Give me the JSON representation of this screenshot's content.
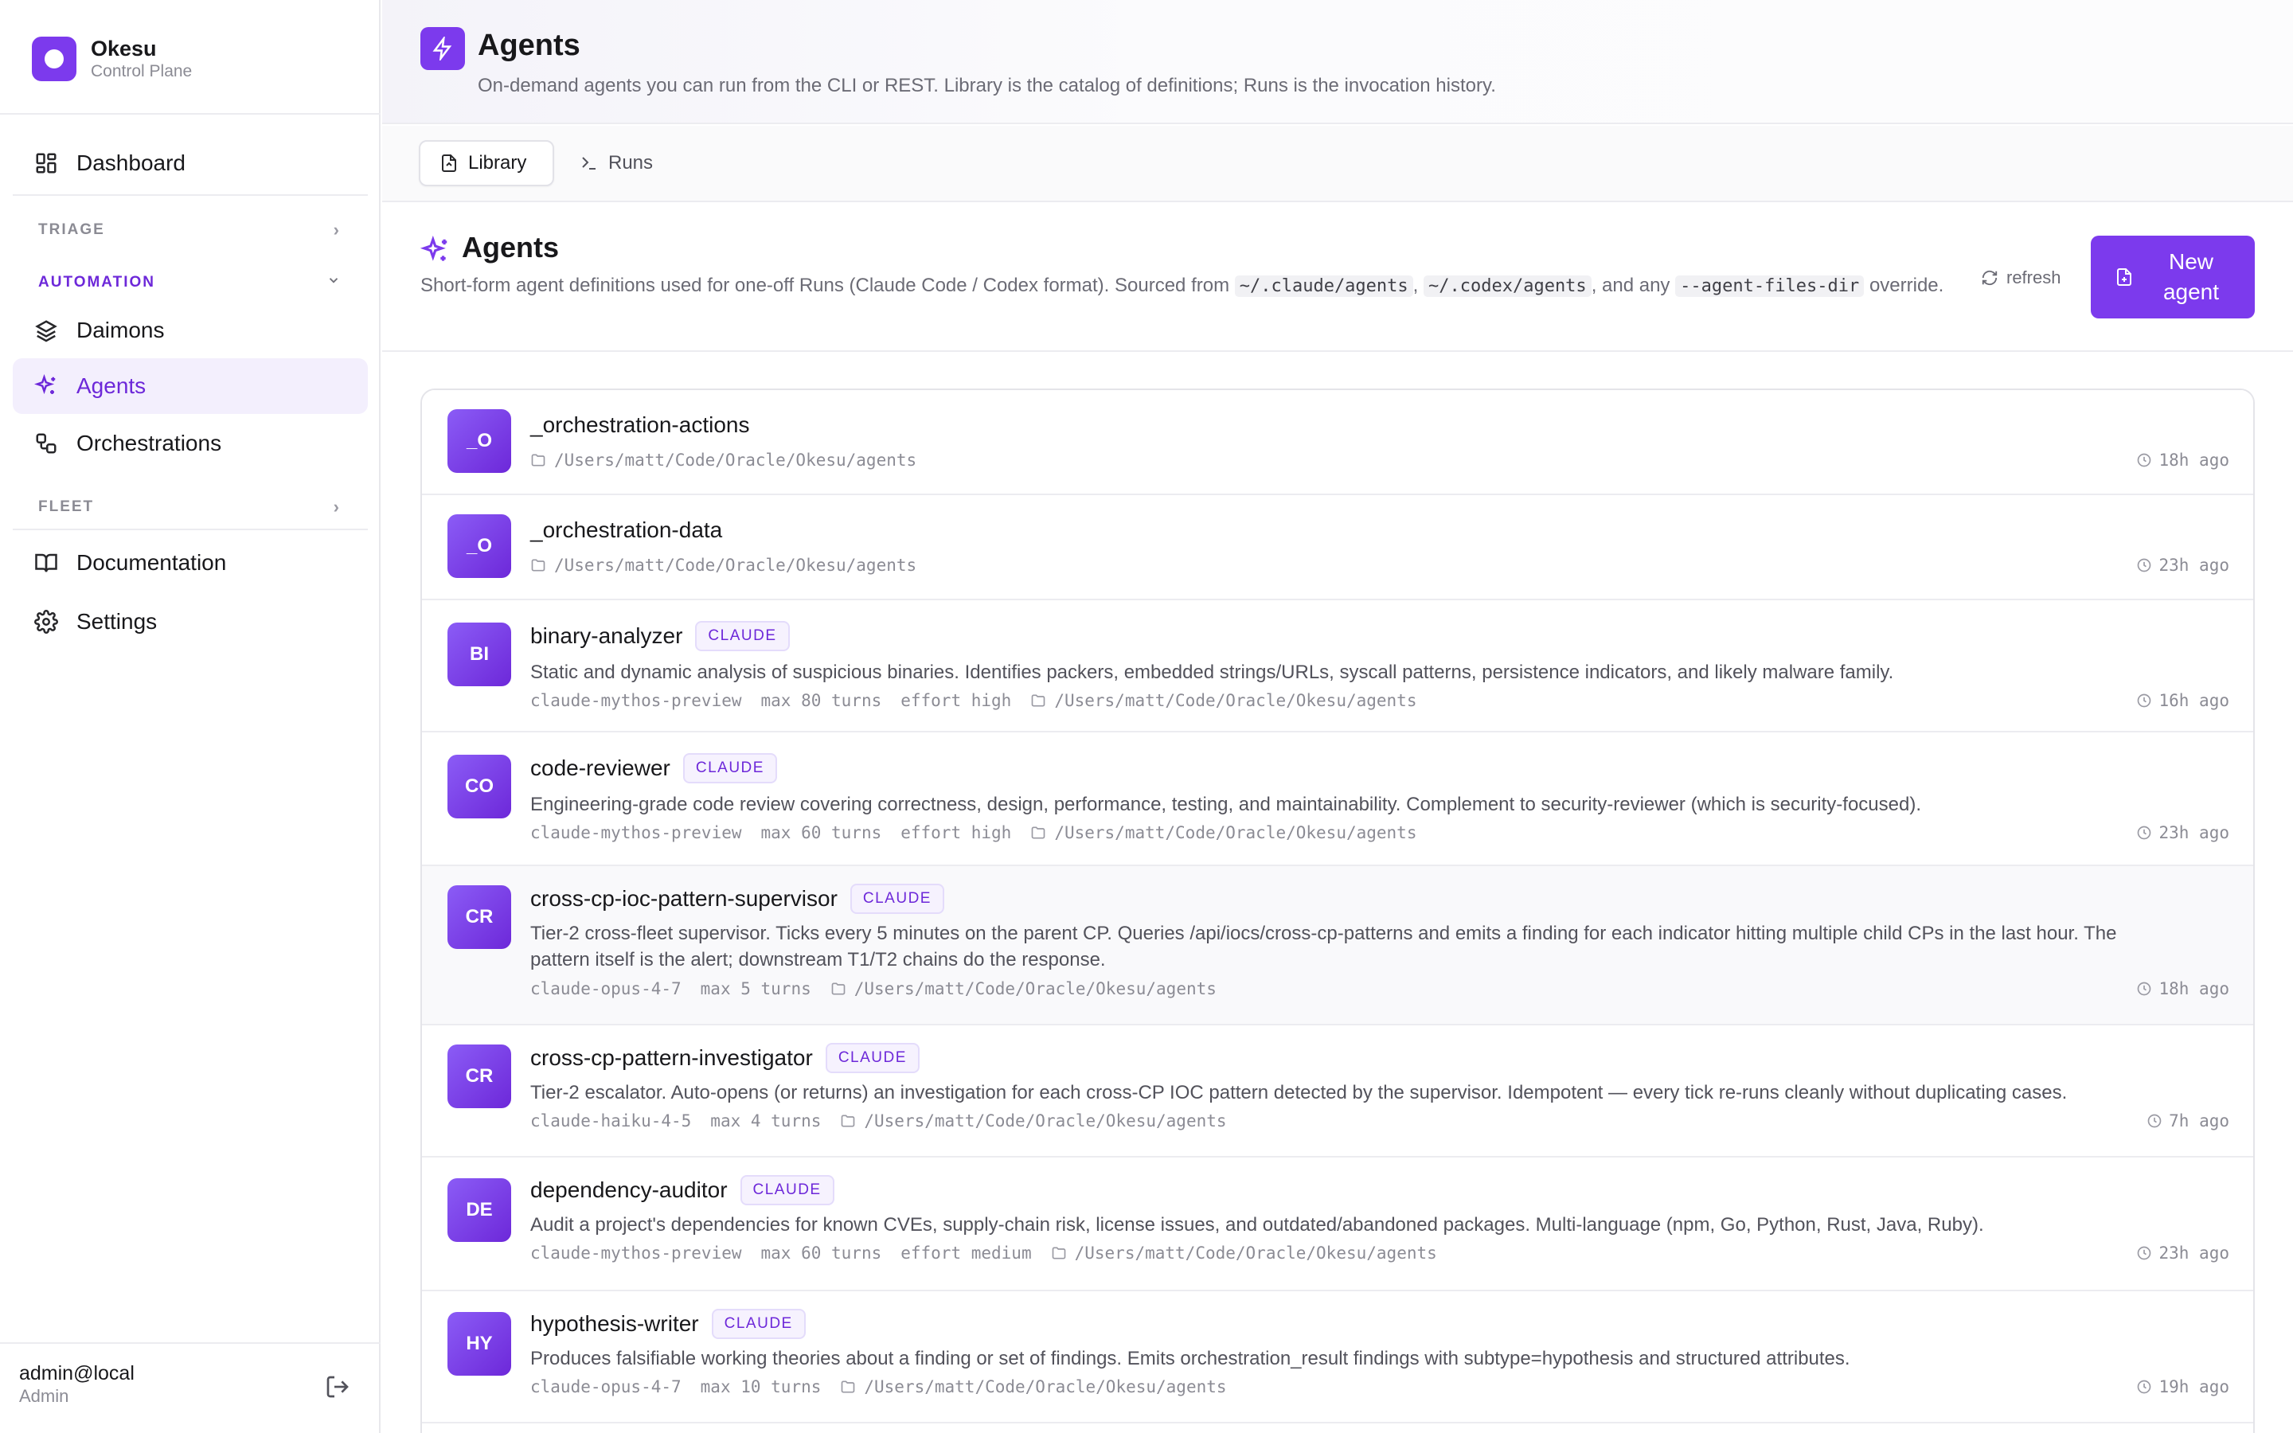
{
  "brand": {
    "name": "Okesu",
    "subtitle": "Control Plane"
  },
  "sidebar": {
    "dashboard": "Dashboard",
    "sections": {
      "triage": "TRIAGE",
      "automation": "AUTOMATION",
      "fleet": "FLEET"
    },
    "items": {
      "daimons": "Daimons",
      "agents": "Agents",
      "orchestrations": "Orchestrations",
      "documentation": "Documentation",
      "settings": "Settings"
    },
    "active": "Agents"
  },
  "user": {
    "name": "admin@local",
    "role": "Admin"
  },
  "page": {
    "title": "Agents",
    "description": "On-demand agents you can run from the CLI or REST. Library is the catalog of definitions; Runs is the invocation history."
  },
  "tabs": [
    {
      "label": "Library",
      "active": true
    },
    {
      "label": "Runs",
      "active": false
    }
  ],
  "section": {
    "title": "Agents",
    "desc_part1": "Short-form agent definitions used for one-off Runs (Claude Code / Codex format). Sourced from ",
    "code1": "~/.claude/agents",
    "sep1": ", ",
    "code2": "~/.codex/agents",
    "sep2": ", and any ",
    "code3": "--agent-files-dir",
    "desc_part2": " override.",
    "refresh_label": "refresh",
    "new_agent_label": "New agent"
  },
  "agents": [
    {
      "initials": "_O",
      "name": "_orchestration-actions",
      "badge": "",
      "description": "",
      "model": "",
      "turns": "",
      "effort": "",
      "path": "/Users/matt/Code/Oracle/Okesu/agents",
      "ago": "18h ago"
    },
    {
      "initials": "_O",
      "name": "_orchestration-data",
      "badge": "",
      "description": "",
      "model": "",
      "turns": "",
      "effort": "",
      "path": "/Users/matt/Code/Oracle/Okesu/agents",
      "ago": "23h ago"
    },
    {
      "initials": "BI",
      "name": "binary-analyzer",
      "badge": "CLAUDE",
      "description": "Static and dynamic analysis of suspicious binaries. Identifies packers, embedded strings/URLs, syscall patterns, persistence indicators, and likely malware family.",
      "model": "claude-mythos-preview",
      "turns": "max 80 turns",
      "effort": "effort high",
      "path": "/Users/matt/Code/Oracle/Okesu/agents",
      "ago": "16h ago"
    },
    {
      "initials": "CO",
      "name": "code-reviewer",
      "badge": "CLAUDE",
      "description": "Engineering-grade code review covering correctness, design, performance, testing, and maintainability. Complement to security-reviewer (which is security-focused).",
      "model": "claude-mythos-preview",
      "turns": "max 60 turns",
      "effort": "effort high",
      "path": "/Users/matt/Code/Oracle/Okesu/agents",
      "ago": "23h ago"
    },
    {
      "initials": "CR",
      "name": "cross-cp-ioc-pattern-supervisor",
      "badge": "CLAUDE",
      "description": "Tier-2 cross-fleet supervisor. Ticks every 5 minutes on the parent CP. Queries /api/iocs/cross-cp-patterns and emits a finding for each indicator hitting multiple child CPs in the last hour. The pattern itself is the alert; downstream T1/T2 chains do the response.",
      "model": "claude-opus-4-7",
      "turns": "max 5 turns",
      "effort": "",
      "path": "/Users/matt/Code/Oracle/Okesu/agents",
      "ago": "18h ago"
    },
    {
      "initials": "CR",
      "name": "cross-cp-pattern-investigator",
      "badge": "CLAUDE",
      "description": "Tier-2 escalator. Auto-opens (or returns) an investigation for each cross-CP IOC pattern detected by the supervisor. Idempotent — every tick re-runs cleanly without duplicating cases.",
      "model": "claude-haiku-4-5",
      "turns": "max 4 turns",
      "effort": "",
      "path": "/Users/matt/Code/Oracle/Okesu/agents",
      "ago": "7h ago"
    },
    {
      "initials": "DE",
      "name": "dependency-auditor",
      "badge": "CLAUDE",
      "description": "Audit a project's dependencies for known CVEs, supply-chain risk, license issues, and outdated/abandoned packages. Multi-language (npm, Go, Python, Rust, Java, Ruby).",
      "model": "claude-mythos-preview",
      "turns": "max 60 turns",
      "effort": "effort medium",
      "path": "/Users/matt/Code/Oracle/Okesu/agents",
      "ago": "23h ago"
    },
    {
      "initials": "HY",
      "name": "hypothesis-writer",
      "badge": "CLAUDE",
      "description": "Produces falsifiable working theories about a finding or set of findings. Emits orchestration_result findings with subtype=hypothesis and structured attributes.",
      "model": "claude-opus-4-7",
      "turns": "max 10 turns",
      "effort": "",
      "path": "/Users/matt/Code/Oracle/Okesu/agents",
      "ago": "19h ago"
    }
  ],
  "colors": {
    "accent": "#7c3aed",
    "accent_soft": "#f3effd"
  },
  "icons": {
    "dashboard": "dashboard-icon",
    "daimons": "layers-icon",
    "agents": "sparkles-icon",
    "orchestrations": "workflow-icon",
    "documentation": "book-icon",
    "settings": "gear-icon",
    "logout": "logout-icon",
    "page": "bolt-icon",
    "library": "file-icon",
    "runs": "terminal-icon",
    "refresh": "refresh-icon",
    "new": "file-plus-icon",
    "folder": "folder-icon",
    "clock": "clock-icon"
  }
}
